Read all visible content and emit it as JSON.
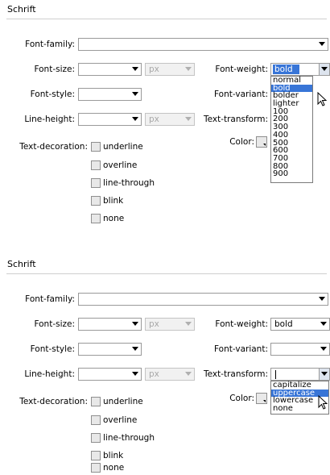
{
  "panel1": {
    "title": "Schrift",
    "labels": {
      "font_family": "Font-family:",
      "font_size": "Font-size:",
      "font_weight": "Font-weight:",
      "font_style": "Font-style:",
      "font_variant": "Font-variant:",
      "line_height": "Line-height:",
      "text_transform": "Text-transform:",
      "text_decoration": "Text-decoration:",
      "color": "Color:"
    },
    "size_unit": "px",
    "line_height_unit": "px",
    "font_weight_value": "bold",
    "decorations": [
      "underline",
      "overline",
      "line-through",
      "blink",
      "none"
    ],
    "weight_options": [
      "normal",
      "bold",
      "bolder",
      "lighter",
      "100",
      "200",
      "300",
      "400",
      "500",
      "600",
      "700",
      "800",
      "900"
    ],
    "weight_highlighted": "bold"
  },
  "panel2": {
    "title": "Schrift",
    "labels": {
      "font_family": "Font-family:",
      "font_size": "Font-size:",
      "font_weight": "Font-weight:",
      "font_style": "Font-style:",
      "font_variant": "Font-variant:",
      "line_height": "Line-height:",
      "text_transform": "Text-transform:",
      "text_decoration": "Text-decoration:",
      "color": "Color:"
    },
    "size_unit": "px",
    "line_height_unit": "px",
    "font_weight_value": "bold",
    "decorations": [
      "underline",
      "overline",
      "line-through",
      "blink",
      "none"
    ],
    "transform_options": [
      "capitalize",
      "uppercase",
      "lowercase",
      "none"
    ],
    "transform_highlighted": "uppercase"
  },
  "colors": {
    "highlight": "#3875d7",
    "rule": "#cfcfcf"
  }
}
